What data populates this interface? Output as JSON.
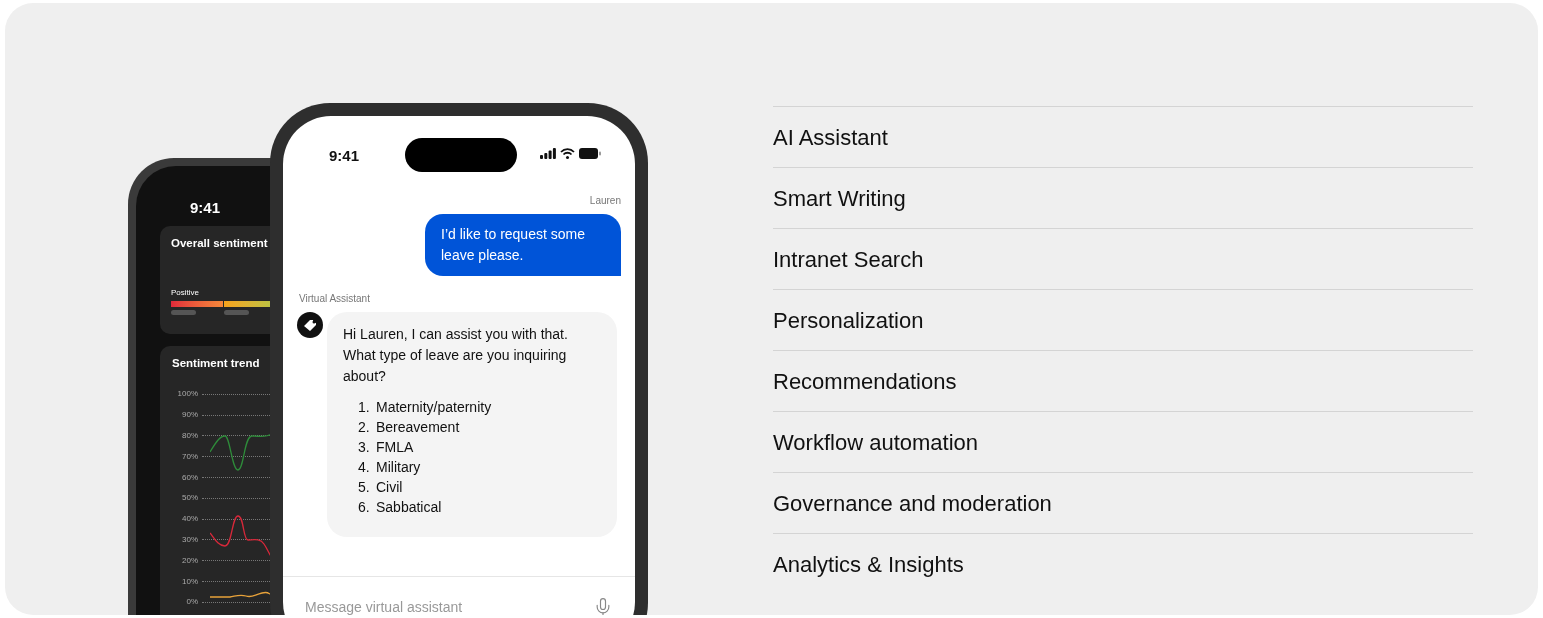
{
  "back_phone": {
    "time": "9:41",
    "overall_card": {
      "title": "Overall sentiment",
      "label": "Positive"
    },
    "trend_card": {
      "title": "Sentiment trend",
      "y_labels": [
        "100%",
        "90%",
        "80%",
        "70%",
        "60%",
        "50%",
        "40%",
        "30%",
        "20%",
        "10%",
        "0%"
      ]
    }
  },
  "front_phone": {
    "time": "9:41",
    "messages": [
      {
        "kind": "user",
        "sender": "Lauren",
        "text": "I’d like to request some leave please."
      },
      {
        "kind": "assistant",
        "sender": "Virtual Assistant",
        "text": "Hi Lauren, I can assist you with that. What type of leave are you inquiring about?",
        "list": [
          {
            "number": "1.",
            "text": "Maternity/paternity"
          },
          {
            "number": "2.",
            "text": "Bereavement"
          },
          {
            "number": "3.",
            "text": "FMLA"
          },
          {
            "number": "4.",
            "text": "Military"
          },
          {
            "number": "5.",
            "text": "Civil"
          },
          {
            "number": "6.",
            "text": "Sabbatical"
          }
        ]
      }
    ],
    "composer": {
      "placeholder": "Message virtual assistant"
    }
  },
  "menu": {
    "items": [
      {
        "label": "AI Assistant"
      },
      {
        "label": "Smart Writing"
      },
      {
        "label": "Intranet Search"
      },
      {
        "label": "Personalization"
      },
      {
        "label": "Recommendations"
      },
      {
        "label": "Workflow automation"
      },
      {
        "label": "Governance and moderation"
      },
      {
        "label": "Analytics & Insights"
      }
    ]
  }
}
